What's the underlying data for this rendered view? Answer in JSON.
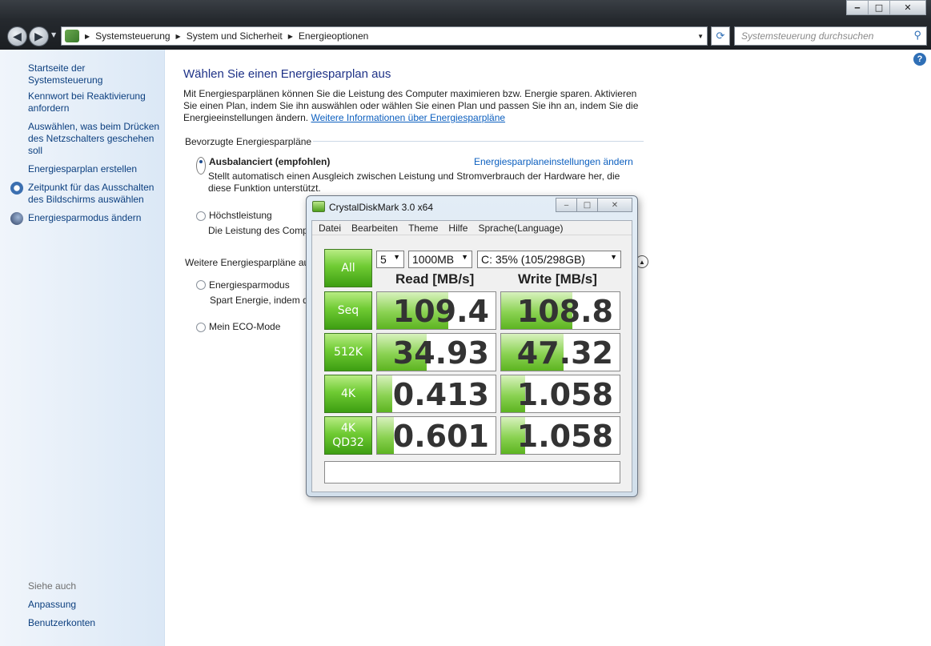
{
  "window": {
    "minimize_label": "‒",
    "maximize_label": "□",
    "close_label": "✕"
  },
  "navbar": {
    "back_label": "◀",
    "forward_label": "▶",
    "breadcrumb": [
      "Systemsteuerung",
      "System und Sicherheit",
      "Energieoptionen"
    ],
    "search_placeholder": "Systemsteuerung durchsuchen"
  },
  "sidebar": {
    "home": "Startseite der Systemsteuerung",
    "items": [
      "Kennwort bei Reaktivierung anfordern",
      "Auswählen, was beim Drücken des Netzschalters geschehen soll",
      "Energiesparplan erstellen",
      "Zeitpunkt für das Ausschalten des Bildschirms auswählen",
      "Energiesparmodus ändern"
    ],
    "see_also_heading": "Siehe auch",
    "see_also": [
      "Anpassung",
      "Benutzerkonten"
    ]
  },
  "main": {
    "title": "Wählen Sie einen Energiesparplan aus",
    "intro": "Mit Energiesparplänen können Sie die Leistung des Computer maximieren bzw. Energie sparen. Aktivieren Sie einen Plan, indem Sie ihn auswählen oder wählen Sie einen Plan und passen Sie ihn an, indem Sie die Energieeinstellungen ändern.",
    "intro_link": "Weitere Informationen über Energiesparpläne",
    "preferred_heading": "Bevorzugte Energiesparpläne",
    "plan1_name": "Ausbalanciert (empfohlen)",
    "plan1_link": "Energiesparplaneinstellungen ändern",
    "plan1_desc": "Stellt automatisch einen Ausgleich zwischen Leistung und Stromverbrauch der Hardware her, die diese Funktion unterstützt.",
    "plan2_name": "Höchstleistung",
    "plan2_desc": "Die Leistung des Comp",
    "more_heading": "Weitere Energiesparpläne au",
    "plan3_name": "Energiesparmodus",
    "plan3_desc": "Spart Energie, indem d",
    "plan4_name": "Mein ECO-Mode"
  },
  "cdm": {
    "title": "CrystalDiskMark 3.0 x64",
    "menu": [
      "Datei",
      "Bearbeiten",
      "Theme",
      "Hilfe",
      "Sprache(Language)"
    ],
    "all_label": "All",
    "count": "5",
    "size": "1000MB",
    "drive": "C: 35% (105/298GB)",
    "read_header": "Read [MB/s]",
    "write_header": "Write [MB/s]",
    "rows": [
      {
        "label": "Seq",
        "read": "109.4",
        "write": "108.8",
        "read_fill": 0.6,
        "write_fill": 0.6
      },
      {
        "label": "512K",
        "read": "34.93",
        "write": "47.32",
        "read_fill": 0.42,
        "write_fill": 0.53
      },
      {
        "label": "4K",
        "read": "0.413",
        "write": "1.058",
        "read_fill": 0.13,
        "write_fill": 0.2
      },
      {
        "label": "4K\nQD32",
        "read": "0.601",
        "write": "1.058",
        "read_fill": 0.14,
        "write_fill": 0.2
      }
    ]
  }
}
